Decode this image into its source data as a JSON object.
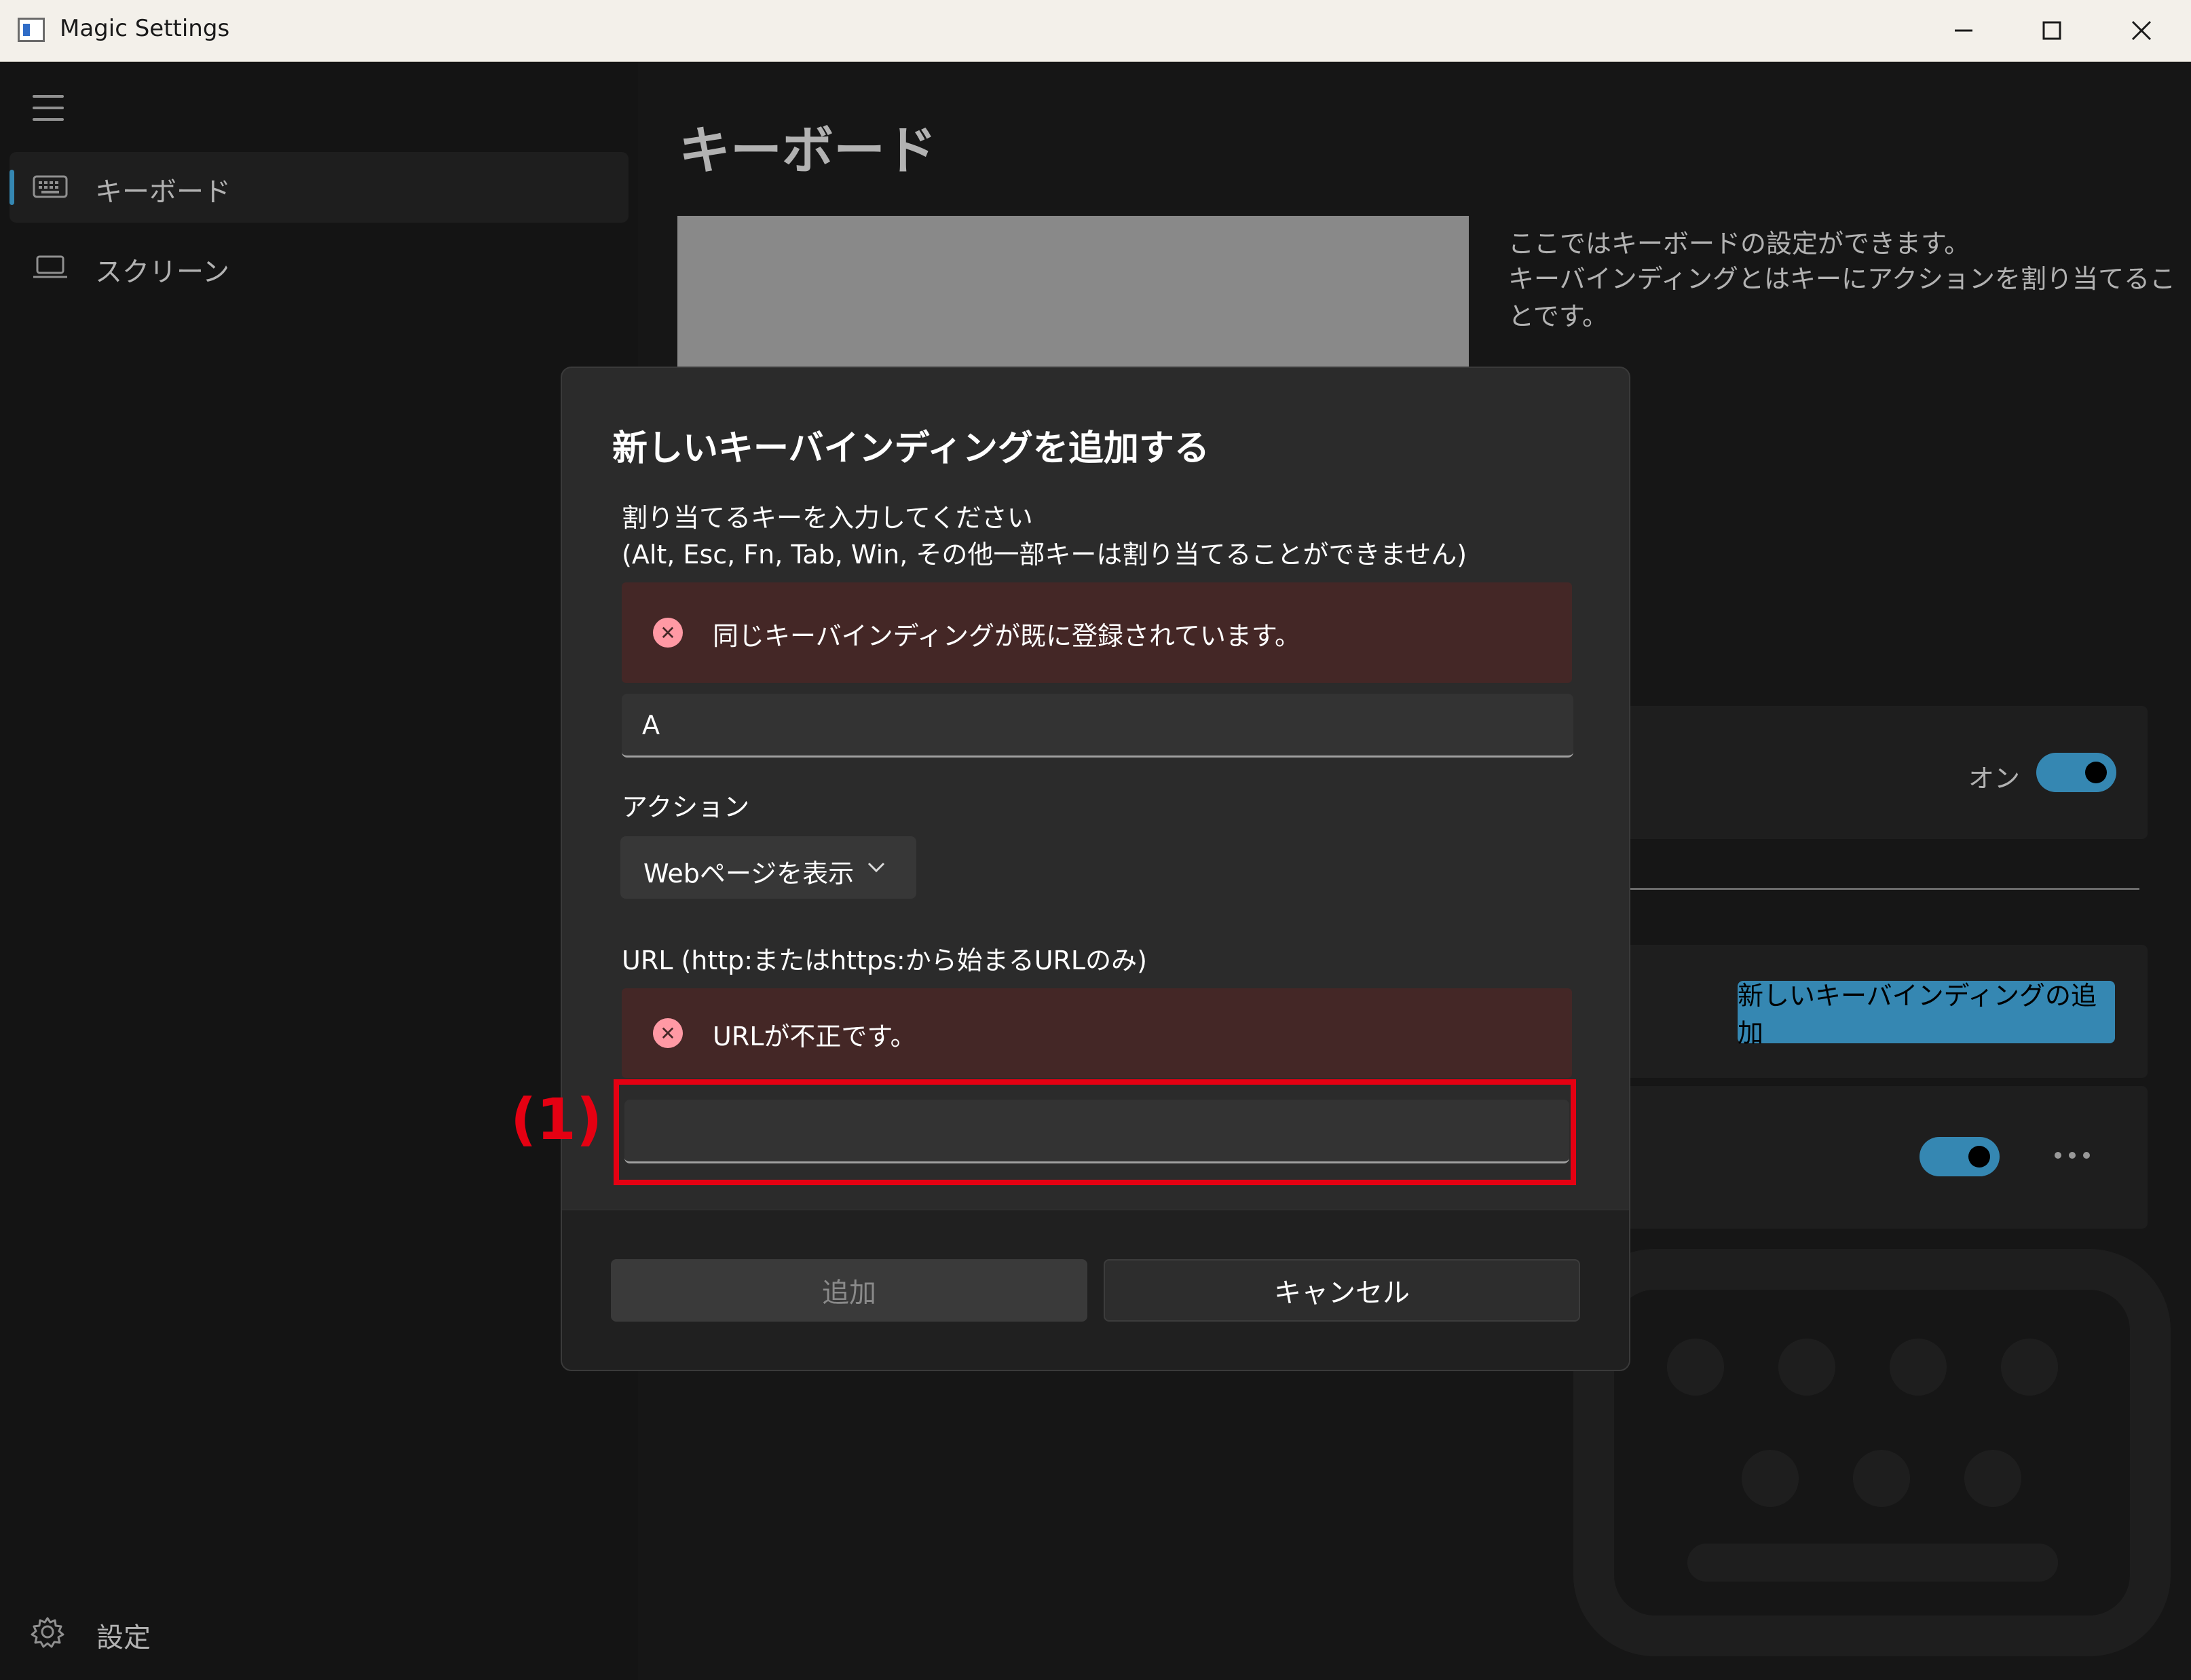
{
  "window": {
    "title": "Magic Settings"
  },
  "sidebar": {
    "items": [
      {
        "label": "キーボード",
        "icon": "keyboard-icon",
        "selected": true
      },
      {
        "label": "スクリーン",
        "icon": "laptop-icon",
        "selected": false
      }
    ],
    "footer": {
      "label": "設定",
      "icon": "gear-icon"
    }
  },
  "main": {
    "title": "キーボード",
    "description_line1": "ここではキーボードの設定ができます。",
    "description_line2": "キーバインディングとはキーにアクションを割り当てることです。",
    "toggle_label": "オン",
    "add_binding_button": "新しいキーバインディングの追加"
  },
  "dialog": {
    "title": "新しいキーバインディングを追加する",
    "key_label_line1": "割り当てるキーを入力してください",
    "key_label_line2": "(Alt, Esc, Fn, Tab, Win, その他一部キーは割り当てることができません)",
    "key_error": "同じキーバインディングが既に登録されています。",
    "key_value": "A",
    "action_label": "アクション",
    "action_selected": "Webページを表示",
    "url_label": "URL (http:またはhttps:から始まるURLのみ)",
    "url_error": "URLが不正です。",
    "url_value": "",
    "add_button": "追加",
    "cancel_button": "キャンセル"
  },
  "annotation": {
    "label": "(1)",
    "color": "#e50012"
  },
  "colors": {
    "accent": "#4cc2ff",
    "error_bg": "#442726",
    "error_icon": "#ff99a4"
  }
}
